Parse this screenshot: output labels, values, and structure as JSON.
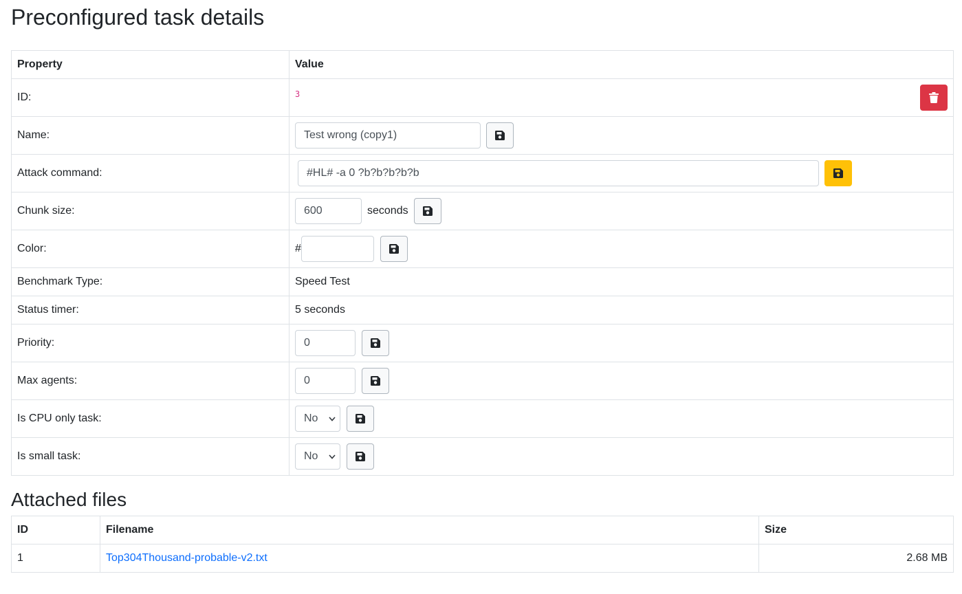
{
  "page_title": "Preconfigured task details",
  "details_table": {
    "headers": {
      "property": "Property",
      "value": "Value"
    },
    "id": {
      "label": "ID:",
      "value": "3"
    },
    "name": {
      "label": "Name:",
      "value": "Test wrong (copy1)"
    },
    "attack_command": {
      "label": "Attack command:",
      "value": "#HL# -a 0 ?b?b?b?b?b"
    },
    "chunk_size": {
      "label": "Chunk size:",
      "value": "600",
      "unit": "seconds"
    },
    "color": {
      "label": "Color:",
      "prefix": "#",
      "value": ""
    },
    "benchmark_type": {
      "label": "Benchmark Type:",
      "value": "Speed Test"
    },
    "status_timer": {
      "label": "Status timer:",
      "value": "5 seconds"
    },
    "priority": {
      "label": "Priority:",
      "value": "0"
    },
    "max_agents": {
      "label": "Max agents:",
      "value": "0"
    },
    "cpu_only": {
      "label": "Is CPU only task:",
      "selected": "No"
    },
    "small_task": {
      "label": "Is small task:",
      "selected": "No"
    }
  },
  "files_title": "Attached files",
  "files_table": {
    "headers": {
      "id": "ID",
      "filename": "Filename",
      "size": "Size"
    },
    "rows": [
      {
        "id": "1",
        "filename": "Top304Thousand-probable-v2.txt",
        "size": "2.68 MB"
      }
    ]
  },
  "icons": {
    "save": "floppy-disk-icon",
    "delete": "trash-icon",
    "dropdown": "chevron-down-icon"
  },
  "colors": {
    "danger": "#dc3545",
    "warning": "#ffc107",
    "link": "#0d6efd",
    "code": "#d63384"
  }
}
